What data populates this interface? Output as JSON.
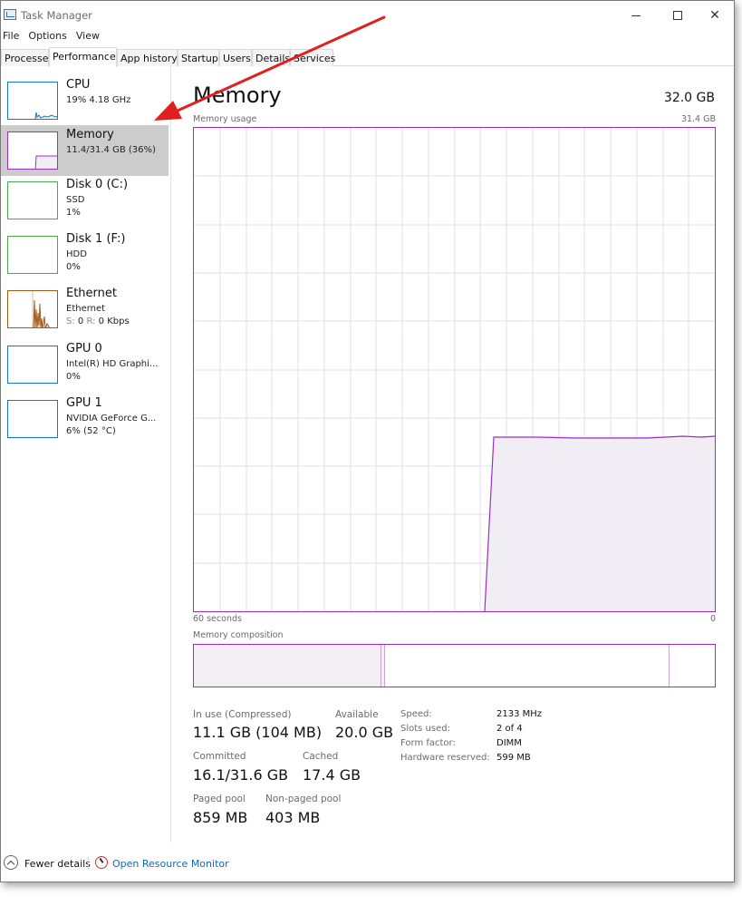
{
  "window": {
    "title": "Task Manager"
  },
  "menu": [
    "File",
    "Options",
    "View"
  ],
  "tabs": [
    "Processes",
    "Performance",
    "App history",
    "Startup",
    "Users",
    "Details",
    "Services"
  ],
  "active_tab": "Performance",
  "sidebar": {
    "items": [
      {
        "title": "CPU",
        "line1": "19% 4.18 GHz",
        "line2": "",
        "color": "#1779ba"
      },
      {
        "title": "Memory",
        "line1": "11.4/31.4 GB (36%)",
        "line2": "",
        "color": "#9c2ec6",
        "selected": true
      },
      {
        "title": "Disk 0 (C:)",
        "line1": "SSD",
        "line2": "1%",
        "color": "#4da84d"
      },
      {
        "title": "Disk 1 (F:)",
        "line1": "HDD",
        "line2": "0%",
        "color": "#4da84d"
      },
      {
        "title": "Ethernet",
        "line1": "Ethernet",
        "line2_s": "S:",
        "line2_s_val": "0",
        "line2_r": "R:",
        "line2_r_val": "0 Kbps",
        "color": "#a05a14"
      },
      {
        "title": "GPU 0",
        "line1": "Intel(R) HD Graphi...",
        "line2": "0%",
        "color": "#1779ba"
      },
      {
        "title": "GPU 1",
        "line1": "NVIDIA GeForce G...",
        "line2": "6% (52 °C)",
        "color": "#1779ba"
      }
    ]
  },
  "main": {
    "title": "Memory",
    "total": "32.0 GB",
    "usage_label": "Memory usage",
    "usage_max": "31.4 GB",
    "axis_left": "60 seconds",
    "axis_right": "0",
    "composition_label": "Memory composition",
    "stats": {
      "in_use_label": "In use (Compressed)",
      "in_use_value": "11.1 GB (104 MB)",
      "available_label": "Available",
      "available_value": "20.0 GB",
      "committed_label": "Committed",
      "committed_value": "16.1/31.6 GB",
      "cached_label": "Cached",
      "cached_value": "17.4 GB",
      "paged_label": "Paged pool",
      "paged_value": "859 MB",
      "nonpaged_label": "Non-paged pool",
      "nonpaged_value": "403 MB"
    },
    "details": {
      "speed_label": "Speed:",
      "speed_value": "2133 MHz",
      "slots_label": "Slots used:",
      "slots_value": "2 of 4",
      "form_label": "Form factor:",
      "form_value": "DIMM",
      "reserved_label": "Hardware reserved:",
      "reserved_value": "599 MB"
    }
  },
  "footer": {
    "fewer_details": "Fewer details",
    "open_resource_monitor": "Open Resource Monitor"
  },
  "colors": {
    "memory": "#9c2ec6",
    "memory_fill": "#f1edf4",
    "grid": "#e6dcec",
    "link": "#1565c0",
    "annotation_arrow": "#e02020"
  }
}
